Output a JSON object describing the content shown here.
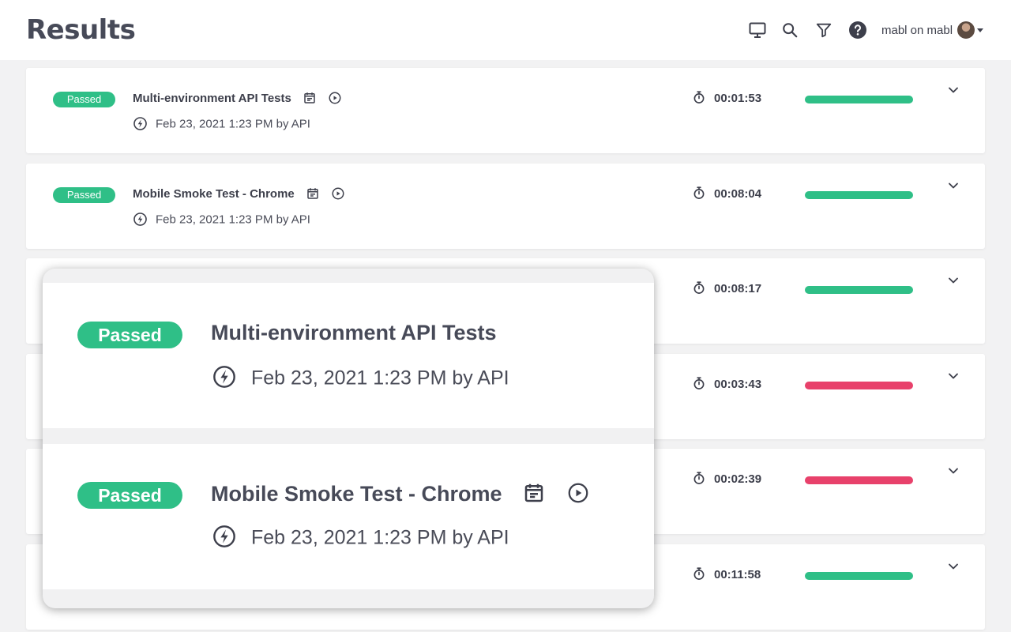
{
  "header": {
    "title": "Results",
    "icons": [
      "monitor-icon",
      "search-icon",
      "filter-icon",
      "help-icon"
    ],
    "user_label": "mabl on mabl"
  },
  "colors": {
    "passed": "#2fbf87",
    "failed": "#e8416b"
  },
  "runs": [
    {
      "status": "Passed",
      "name": "Multi-environment API Tests",
      "meta": "Feb 23, 2021 1:23 PM by API",
      "duration": "00:01:53",
      "result": "passed"
    },
    {
      "status": "Passed",
      "name": "Mobile Smoke Test - Chrome",
      "meta": "Feb 23, 2021 1:23 PM by API",
      "duration": "00:08:04",
      "result": "passed"
    },
    {
      "duration": "00:08:17",
      "result": "passed"
    },
    {
      "duration": "00:03:43",
      "result": "failed"
    },
    {
      "duration": "00:02:39",
      "result": "failed"
    },
    {
      "duration": "00:11:58",
      "result": "passed"
    }
  ],
  "zoom": [
    {
      "status": "Passed",
      "name": "Multi-environment API Tests",
      "meta": "Feb 23, 2021 1:23 PM by API"
    },
    {
      "status": "Passed",
      "name": "Mobile Smoke Test - Chrome",
      "meta": "Feb 23, 2021 1:23 PM by API"
    }
  ]
}
